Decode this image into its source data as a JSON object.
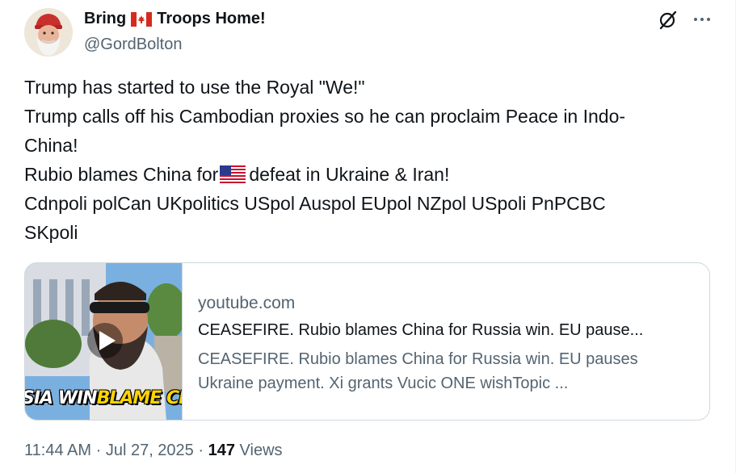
{
  "author": {
    "name_part1": "Bring",
    "name_part2": "Troops Home!",
    "handle": "@GordBolton"
  },
  "tweet": {
    "lines": [
      "Trump has started to use the Royal \"We!\"",
      "Trump calls off his Cambodian proxies so he can proclaim Peace in Indo-",
      "China!",
      "",
      "Cdnpoli polCan UKpolitics USpol Auspol EUpol NZpol USpoli PnPCBC",
      "SKpoli"
    ],
    "line4_before": "Rubio blames China for",
    "line4_after": "defeat in Ukraine & Iran!"
  },
  "card": {
    "domain": "youtube.com",
    "title": "CEASEFIRE. Rubio blames China for Russia win. EU pause...",
    "description_line1": "CEASEFIRE. Rubio blames China for Russia win. EU pauses",
    "description_line2": "Ukraine payment. Xi grants Vucic ONE wishTopic ...",
    "thumbnail_caption_white": "SIA WIN",
    "thumbnail_caption_yellow": "BLAME CH"
  },
  "meta": {
    "time": "11:44 AM",
    "date": "Jul 27, 2025",
    "separator": "·",
    "views_count": "147",
    "views_label": "Views"
  },
  "icons": {
    "grok": "grok-icon",
    "more": "more-icon",
    "canada_flag": "canada-flag-icon",
    "us_flag": "us-flag-icon",
    "play": "play-icon"
  },
  "colors": {
    "text_primary": "#0f1419",
    "text_secondary": "#536471",
    "border": "#cfd9de",
    "caption_yellow": "#ffd400"
  }
}
